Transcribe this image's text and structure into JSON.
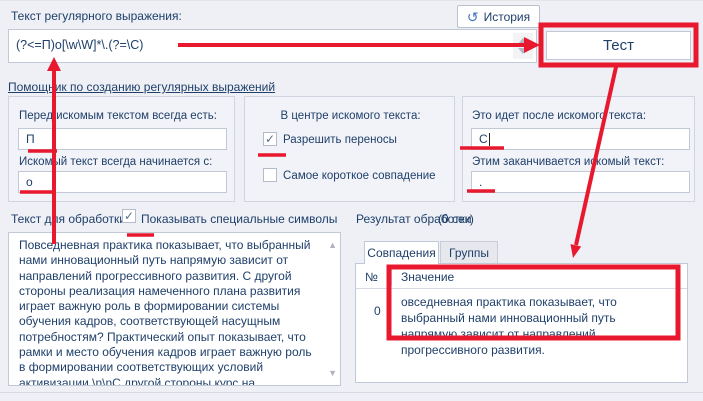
{
  "regex_section": {
    "label": "Текст регулярного выражения:",
    "value": "(?<=П)о[\\w\\W]*\\.(?=\\С)",
    "history_button": "История",
    "test_button": "Тест"
  },
  "helper": {
    "title": "Помощник по созданию регулярных выражений",
    "before_label": "Перед искомым текстом всегда есть:",
    "before_value": "П",
    "starts_label": "Искомый текст всегда начинается с:",
    "starts_value": "о",
    "center_label": "В центре искомого текста:",
    "allow_breaks_label": "Разрешить переносы",
    "allow_breaks_checked": true,
    "shortest_match_label": "Самое короткое совпадение",
    "shortest_match_checked": false,
    "after_label": "Это идет после искомого текста:",
    "after_value": "С",
    "ends_label": "Этим заканчивается искомый текст:",
    "ends_value": "."
  },
  "source": {
    "label": "Текст для обработки",
    "show_special_label": "Показывать специальные символы",
    "show_special_checked": true,
    "text": "Повседневная практика показывает, что выбранный нами инновационный путь напрямую зависит от направлений прогрессивного развития. С другой стороны реализация намеченного плана развития играет важную роль в формировании системы обучения кадров, соответствующей насущным потребностям? Практический опыт показывает, что рамки и место обучения кадров играет важную роль в формировании соответствующих условий активизации.\\n\\nС другой стороны курс на социально-ориентированный национальный проект"
  },
  "result": {
    "label": "Результат обработки",
    "time": "(0 сек)",
    "tabs": [
      {
        "label": "Совпадения",
        "active": true
      },
      {
        "label": "Группы",
        "active": false
      }
    ],
    "columns": [
      "№",
      "Значение"
    ],
    "rows": [
      {
        "num": "0",
        "value": "овседневная практика показывает, что выбранный нами инновационный путь напрямую зависит от направлений прогрессивного развития."
      }
    ]
  },
  "icons": {
    "history": "↺",
    "check": "✓",
    "scroll_up": "▲",
    "scroll_down": "▼"
  },
  "colors": {
    "annotation_red": "#e8192e",
    "text_navy": "#20406a",
    "page_background": "#eef0f6",
    "input_border": "#c2c9d6"
  }
}
